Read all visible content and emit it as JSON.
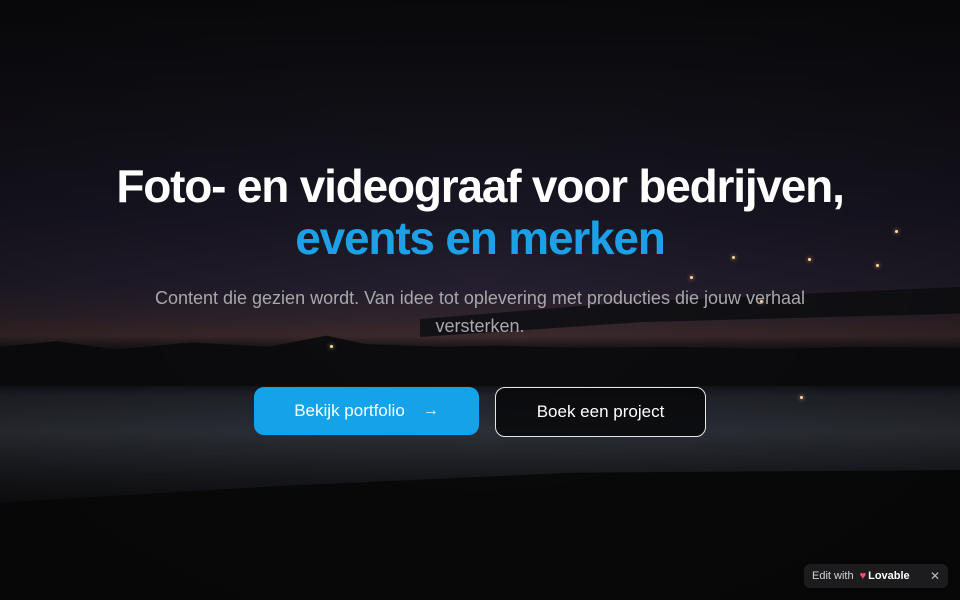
{
  "hero": {
    "headline_line1": "Foto- en videograaf voor bedrijven,",
    "headline_line2": "events en merken",
    "subtitle": "Content die gezien wordt. Van idee tot oplevering met producties die jouw verhaal versterken.",
    "accent_color": "#1ea0e6"
  },
  "actions": {
    "primary_label": "Bekijk portfolio",
    "primary_icon": "arrow-right-icon",
    "secondary_label": "Boek een project"
  },
  "badge": {
    "prefix": "Edit with",
    "brand": "Lovable",
    "brand_icon": "heart-icon",
    "close_icon": "close-icon"
  }
}
